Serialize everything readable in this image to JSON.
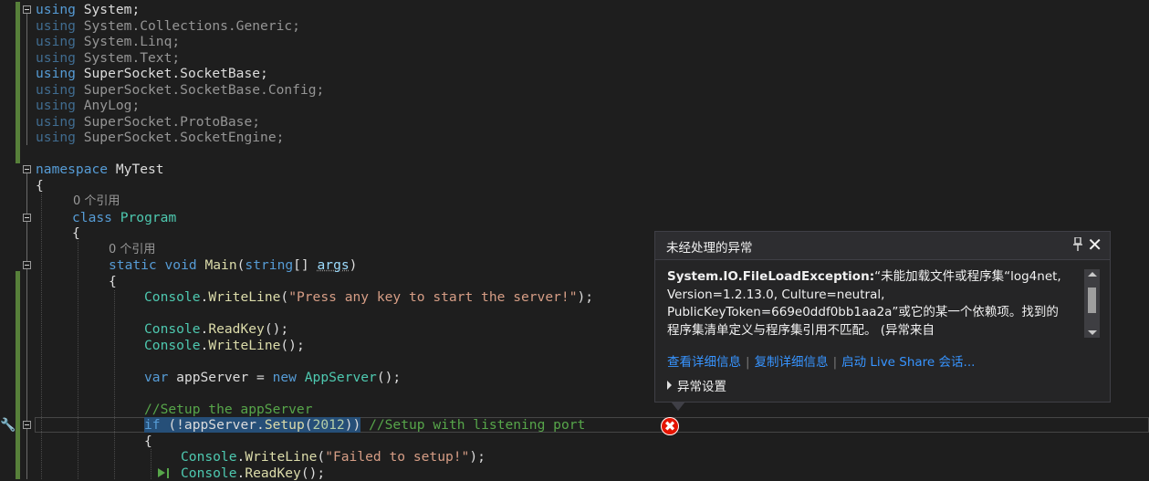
{
  "code": {
    "usings": [
      "using",
      "System;",
      "System.Collections.Generic;",
      "System.Linq;",
      "System.Text;",
      "SuperSocket.SocketBase;",
      "SuperSocket.SocketBase.Config;",
      "AnyLog;",
      "SuperSocket.ProtoBase;",
      "SuperSocket.SocketEngine;"
    ],
    "kw_using": "using",
    "kw_namespace": "namespace",
    "ns_name": "MyTest",
    "open_brace": "{",
    "codelens_refs": "0 个引用",
    "kw_class": "class",
    "class_name": "Program",
    "kw_static": "static",
    "kw_void": "void",
    "method_main": "Main",
    "paren_open": "(",
    "kw_string": "string",
    "array_brackets": "[] ",
    "param_args": "args",
    "paren_close": ")",
    "console": "Console",
    "dot": ".",
    "writeline": "WriteLine",
    "readkey": "ReadKey",
    "str_press": "\"Press any key to start the server!\"",
    "tail_semicolon": ");",
    "empty_call": "();",
    "kw_var": "var",
    "var_appserver": "appServer",
    "assign": " = ",
    "kw_new": "new",
    "type_appserver": "AppServer",
    "comment_setup": "//Setup the appServer",
    "kw_if": "if",
    "if_open": " (!appServer.",
    "setup": "Setup",
    "num_2012": "2012",
    "if_close": "))",
    "comment_listen": "//Setup with listening port",
    "str_failed": "\"Failed to setup!\""
  },
  "exception_popup": {
    "title": "未经处理的异常",
    "exception_type": "System.IO.FileLoadException:",
    "message": "“未能加载文件或程序集“log4net, Version=1.2.13.0, Culture=neutral, PublicKeyToken=669e0ddf0bb1aa2a”或它的某一个依赖项。找到的程序集清单定义与程序集引用不匹配。 (异常来自",
    "links": [
      "查看详细信息",
      "复制详细信息",
      "启动 Live Share 会话..."
    ],
    "settings_label": "异常设置",
    "pin_glyph": "ꟷ",
    "close_glyph": "✕"
  },
  "error_glyph": "✖",
  "colors": {
    "keyword": "#569cd6",
    "type": "#4ec9b0",
    "method": "#dcdcaa",
    "string": "#d69d85",
    "comment": "#57a64a",
    "link": "#3794ff",
    "error": "#e51400"
  }
}
